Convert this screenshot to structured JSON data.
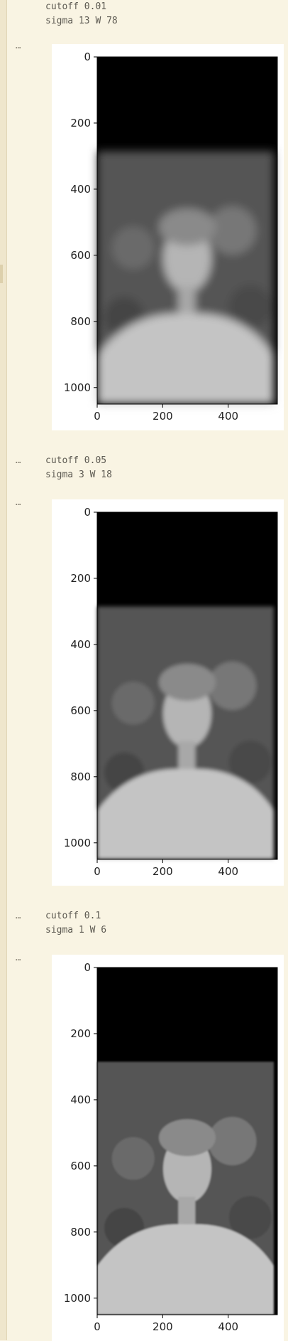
{
  "cells": [
    {
      "lines": [
        "cutoff 0.01",
        "sigma 13 W 78"
      ],
      "plot": {
        "yticks": [
          "0",
          "200",
          "400",
          "600",
          "800",
          "1000"
        ],
        "xticks": [
          "0",
          "200",
          "400"
        ],
        "edge_y": 285,
        "sharpness": "blurry"
      }
    },
    {
      "lines": [
        "cutoff 0.05",
        "sigma 3 W 18"
      ],
      "plot": {
        "yticks": [
          "0",
          "200",
          "400",
          "600",
          "800",
          "1000"
        ],
        "xticks": [
          "0",
          "200",
          "400"
        ],
        "edge_y": 285,
        "sharpness": "medium"
      }
    },
    {
      "lines": [
        "cutoff 0.1",
        "sigma 1 W 6"
      ],
      "plot": {
        "yticks": [
          "0",
          "200",
          "400",
          "600",
          "800",
          "1000"
        ],
        "xticks": [
          "0",
          "200",
          "400"
        ],
        "edge_y": 285,
        "sharpness": "sharp"
      }
    }
  ],
  "more_label": "⋯",
  "colors": {
    "background": "#f9f4e3",
    "figure_bg": "#ffffff",
    "text": "#5d5a52"
  }
}
